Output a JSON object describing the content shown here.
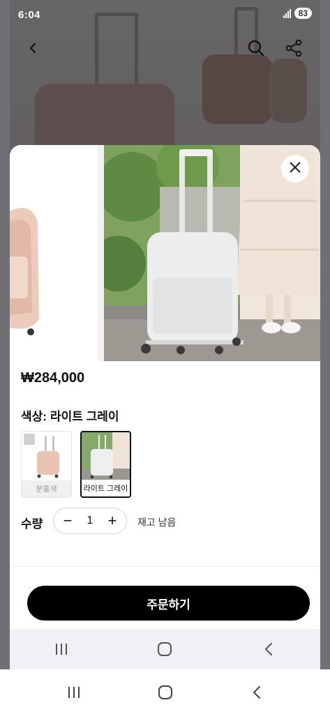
{
  "status_bar": {
    "time": "6:04",
    "battery": "83"
  },
  "product": {
    "price": "₩284,000",
    "color_label": "색상:",
    "color_value": "라이트 그레이",
    "variants": [
      {
        "label": "분홍색",
        "selected": false
      },
      {
        "label": "라이트 그레이",
        "selected": true
      }
    ],
    "quantity_label": "수량",
    "quantity": "1",
    "minus_symbol": "−",
    "plus_symbol": "+",
    "stock_text": "재고 남음"
  },
  "order_button": "주문하기",
  "icons": {
    "back": "chevron-left-icon",
    "search": "search-icon",
    "share": "share-icon",
    "close": "close-icon",
    "nav_recents": "recents-icon",
    "nav_home": "home-icon",
    "nav_back": "back-icon"
  },
  "colors": {
    "primary": "#000000",
    "sheet": "#ffffff",
    "overlay": "#2a2a30"
  }
}
